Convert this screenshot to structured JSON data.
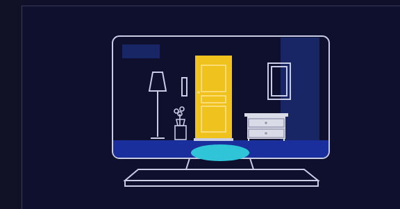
{
  "colors": {
    "background": "#10102b",
    "panel": "#0f0f2e",
    "panel_border": "#3a3a5a",
    "line": "#c9cde6",
    "door": "#f0c21e",
    "door_trim": "#ffe28a",
    "floor": "#1b2f9c",
    "wall_shadow": "#1a2a6e",
    "rug": "#2fc4d8",
    "dresser": "#d9dbe6"
  },
  "icons": {
    "illustration": "tv-screen-room-icon",
    "door": "door-icon",
    "lamp": "floor-lamp-icon",
    "plant": "potted-plant-icon",
    "frame": "picture-frame-icon",
    "dresser": "dresser-icon",
    "rug": "rug-icon"
  }
}
